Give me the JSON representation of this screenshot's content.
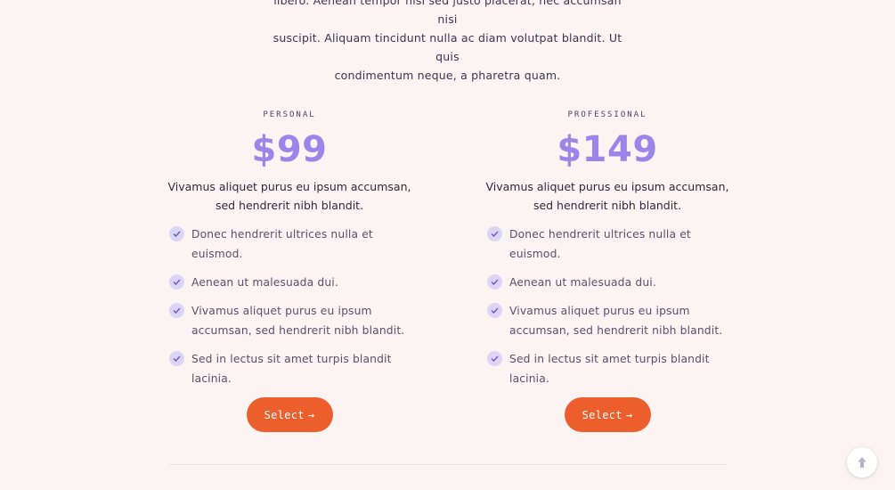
{
  "intro": {
    "line1": "libero. Aenean tempor nisl sed justo placerat, nec accumsan nisi",
    "line2": "suscipit. Aliquam tincidunt nulla ac diam volutpat blandit. Ut quis",
    "line3": "condimentum neque, a pharetra quam."
  },
  "plans": [
    {
      "name": "PERSONAL",
      "price": "$99",
      "description": "Vivamus aliquet purus eu ipsum accumsan, sed hendrerit nibh blandit.",
      "features": [
        "Donec hendrerit ultrices nulla et euismod.",
        "Aenean ut malesuada dui.",
        "Vivamus aliquet purus eu ipsum accumsan, sed hendrerit nibh blandit.",
        "Sed in lectus sit amet turpis blandit lacinia."
      ],
      "button_label": "Select",
      "button_icon": "arrow-right-icon"
    },
    {
      "name": "PROFESSIONAL",
      "price": "$149",
      "description": "Vivamus aliquet purus eu ipsum accumsan, sed hendrerit nibh blandit.",
      "features": [
        "Donec hendrerit ultrices nulla et euismod.",
        "Aenean ut malesuada dui.",
        "Vivamus aliquet purus eu ipsum accumsan, sed hendrerit nibh blandit.",
        "Sed in lectus sit amet turpis blandit lacinia."
      ],
      "button_label": "Select",
      "button_icon": "arrow-right-icon"
    }
  ],
  "scroll_top": {
    "icon": "arrow-up-icon"
  },
  "colors": {
    "background": "#fcf3f3",
    "price": "#9a86e8",
    "button": "#ec5f2d",
    "check_bg": "#dcd5f5"
  }
}
